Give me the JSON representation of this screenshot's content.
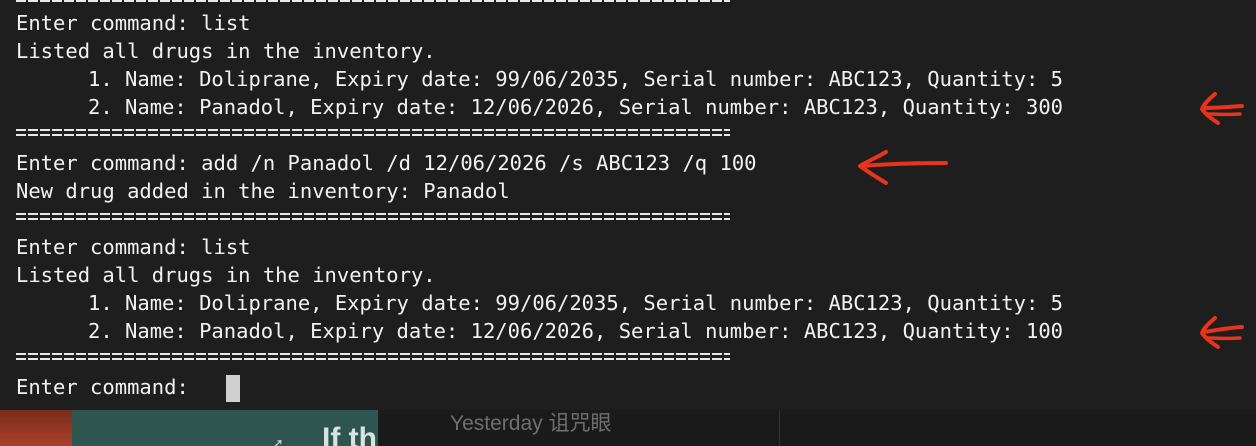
{
  "terminal": {
    "lines": [
      "Enter command: list",
      "Listed all drugs in the inventory.",
      "1. Name: Doliprane, Expiry date: 99/06/2035, Serial number: ABC123, Quantity: 5",
      "2. Name: Panadol, Expiry date: 12/06/2026, Serial number: ABC123, Quantity: 300",
      "Enter command: add /n Panadol /d 12/06/2026 /s ABC123 /q 100",
      "New drug added in the inventory: Panadol",
      "Enter command: list",
      "Listed all drugs in the inventory.",
      "1. Name: Doliprane, Expiry date: 99/06/2035, Serial number: ABC123, Quantity: 5",
      "2. Name: Panadol, Expiry date: 12/06/2026, Serial number: ABC123, Quantity: 100",
      "Enter command: "
    ]
  },
  "annotation_color": "#e8331d",
  "background_windows": {
    "teal_window_text": "If the al",
    "dark_window_text": "Yesterday  诅咒眼"
  },
  "colors": {
    "terminal_bg": "#1e1e1e",
    "terminal_text": "#f2f2f2",
    "cursor": "#d0d0d0"
  }
}
